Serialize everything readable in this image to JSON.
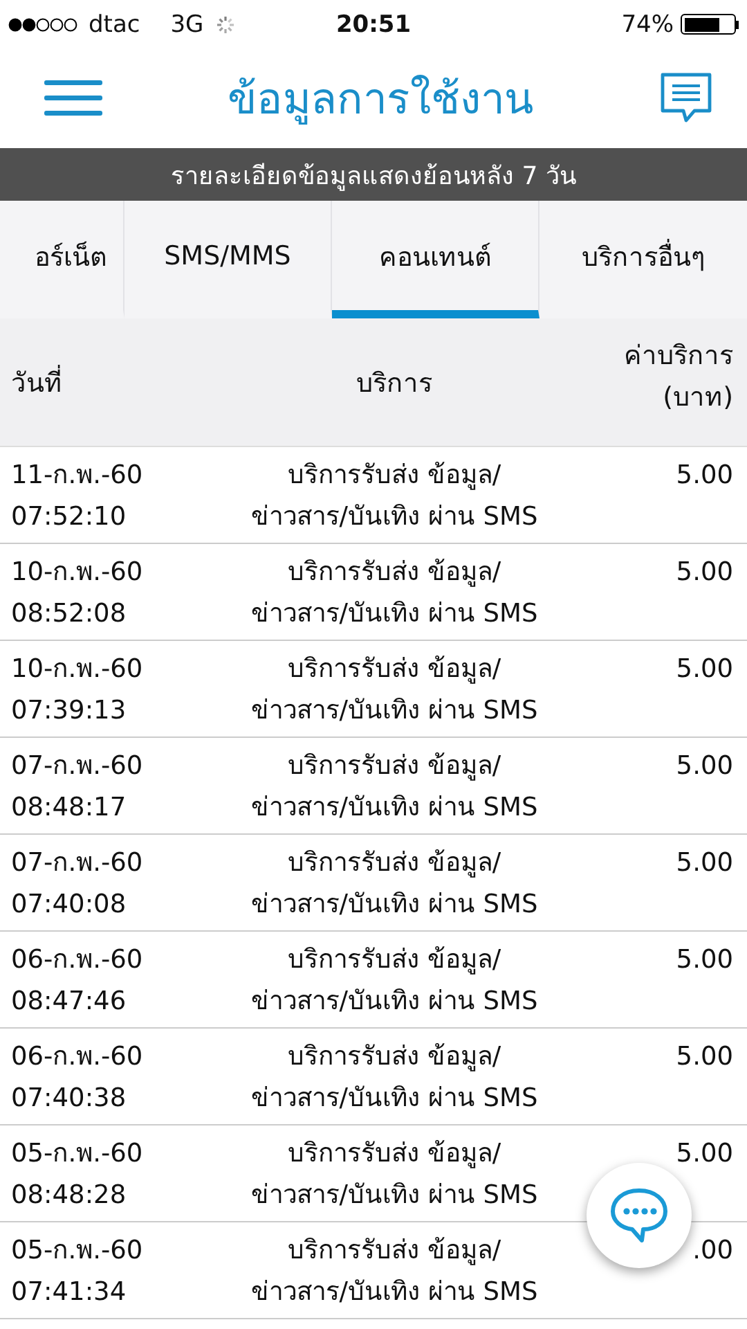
{
  "status_bar": {
    "carrier": "dtac",
    "network": "3G",
    "time": "20:51",
    "battery_text": "74%",
    "battery": {
      "level": 0.74
    }
  },
  "header": {
    "title": "ข้อมูลการใช้งาน"
  },
  "banner": "รายละเอียดข้อมูลแสดงย้อนหลัง 7 วัน",
  "tabs": [
    {
      "label": "อร์เน็ต",
      "selected": false
    },
    {
      "label": "SMS/MMS",
      "selected": false
    },
    {
      "label": "คอนเทนต์",
      "selected": true
    },
    {
      "label": "บริการอื่นๆ",
      "selected": false
    }
  ],
  "table": {
    "columns": [
      "วันที่",
      "บริการ",
      "ค่าบริการ (บาท)"
    ],
    "rows": [
      {
        "date": "11-ก.พ.-60",
        "time": "07:52:10",
        "service": "บริการรับส่ง ข้อมูล/ ข่าวสาร/บันเทิง ผ่าน SMS",
        "price": "5.00"
      },
      {
        "date": "10-ก.พ.-60",
        "time": "08:52:08",
        "service": "บริการรับส่ง ข้อมูล/ ข่าวสาร/บันเทิง ผ่าน SMS",
        "price": "5.00"
      },
      {
        "date": "10-ก.พ.-60",
        "time": "07:39:13",
        "service": "บริการรับส่ง ข้อมูล/ ข่าวสาร/บันเทิง ผ่าน SMS",
        "price": "5.00"
      },
      {
        "date": "07-ก.พ.-60",
        "time": "08:48:17",
        "service": "บริการรับส่ง ข้อมูล/ ข่าวสาร/บันเทิง ผ่าน SMS",
        "price": "5.00"
      },
      {
        "date": "07-ก.พ.-60",
        "time": "07:40:08",
        "service": "บริการรับส่ง ข้อมูล/ ข่าวสาร/บันเทิง ผ่าน SMS",
        "price": "5.00"
      },
      {
        "date": "06-ก.พ.-60",
        "time": "08:47:46",
        "service": "บริการรับส่ง ข้อมูล/ ข่าวสาร/บันเทิง ผ่าน SMS",
        "price": "5.00"
      },
      {
        "date": "06-ก.พ.-60",
        "time": "07:40:38",
        "service": "บริการรับส่ง ข้อมูล/ ข่าวสาร/บันเทิง ผ่าน SMS",
        "price": "5.00"
      },
      {
        "date": "05-ก.พ.-60",
        "time": "08:48:28",
        "service": "บริการรับส่ง ข้อมูล/ ข่าวสาร/บันเทิง ผ่าน SMS",
        "price": "5.00"
      },
      {
        "date": "05-ก.พ.-60",
        "time": "07:41:34",
        "service": "บริการรับส่ง ข้อมูล/ ข่าวสาร/บันเทิง ผ่าน SMS",
        "price": ".00"
      }
    ]
  }
}
